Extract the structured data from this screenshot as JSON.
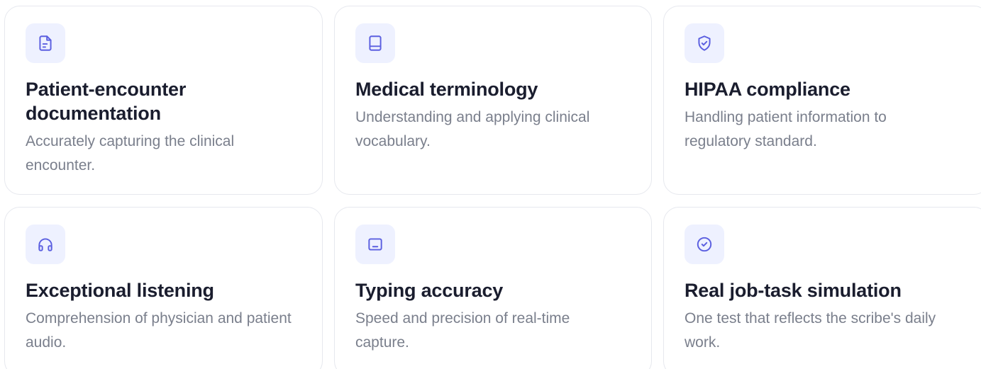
{
  "colors": {
    "accent": "#5b5fe0",
    "icon_bg": "#eef1ff",
    "title": "#1a1d2e",
    "description": "#7a7f8c",
    "border": "#e6e8ee"
  },
  "cards": [
    {
      "icon": "document-icon",
      "title": "Patient-encounter documentation",
      "description": "Accurately capturing the clinical encounter."
    },
    {
      "icon": "book-icon",
      "title": "Medical terminology",
      "description": "Understanding and applying clinical vocabulary."
    },
    {
      "icon": "shield-check-icon",
      "title": "HIPAA compliance",
      "description": "Handling patient information to regulatory standard."
    },
    {
      "icon": "headphones-icon",
      "title": "Exceptional listening",
      "description": "Comprehension of physician and patient audio."
    },
    {
      "icon": "tablet-icon",
      "title": "Typing accuracy",
      "description": "Speed and precision of real-time capture."
    },
    {
      "icon": "check-circle-icon",
      "title": "Real job-task simulation",
      "description": "One test that reflects the scribe's daily work."
    }
  ]
}
